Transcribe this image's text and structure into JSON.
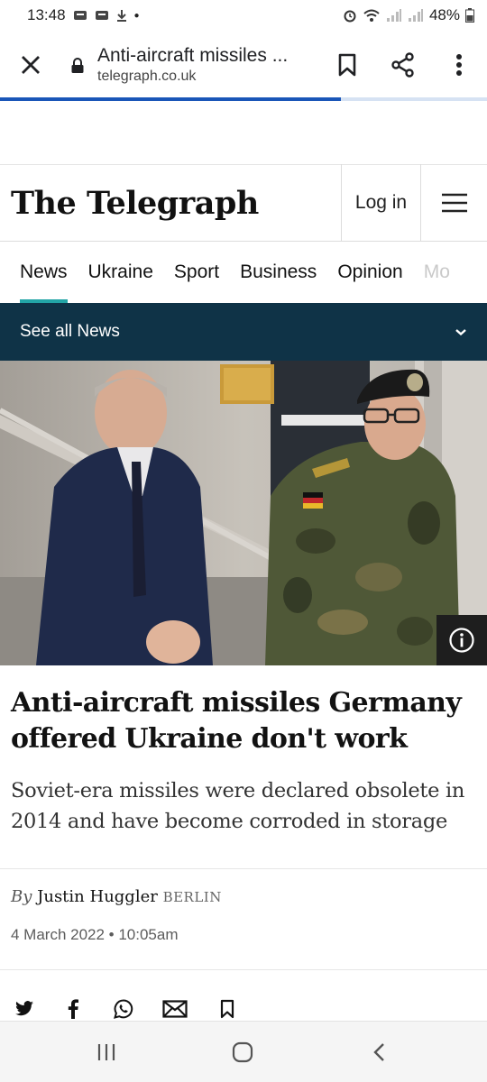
{
  "status": {
    "time": "13:48",
    "battery": "48%"
  },
  "browser": {
    "page_title": "Anti-aircraft missiles ...",
    "domain": "telegraph.co.uk",
    "load_progress": 0.7
  },
  "masthead": {
    "logo": "The Telegraph",
    "login_label": "Log in"
  },
  "nav": {
    "items": [
      "News",
      "Ukraine",
      "Sport",
      "Business",
      "Opinion",
      "Mo"
    ],
    "active": "News"
  },
  "section_bar": {
    "label": "See all News"
  },
  "article": {
    "headline": "Anti-aircraft missiles Germany offered Ukraine don't work",
    "standfirst": "Soviet-era missiles were declared obsolete in 2014 and have become corroded in storage",
    "byline_prefix": "By",
    "author": "Justin Huggler",
    "location": "BERLIN",
    "date": "4 March 2022 • 10:05am"
  },
  "icons": {
    "close": "close-icon",
    "lock": "lock-icon",
    "bookmark": "bookmark-icon",
    "share": "share-icon",
    "more": "more-vert-icon",
    "menu": "hamburger-icon",
    "info": "info-icon"
  },
  "colors": {
    "nav_accent": "#23a5a6",
    "section_bar": "#0f3347",
    "progress": "#1a56b8"
  }
}
